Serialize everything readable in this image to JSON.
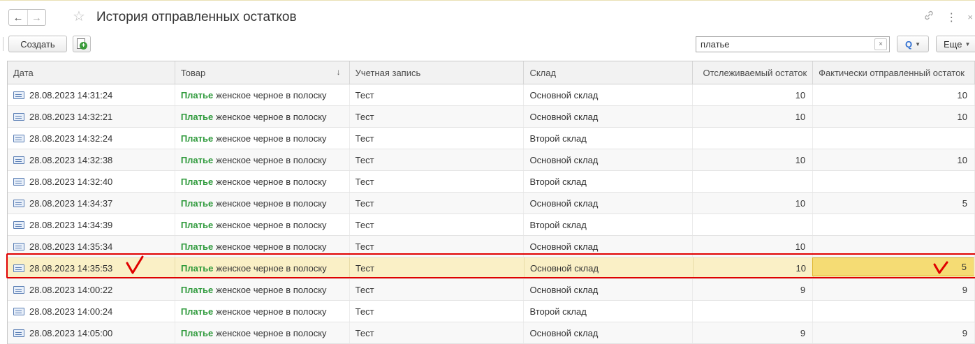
{
  "header": {
    "title": "История отправленных остатков",
    "back_glyph": "←",
    "forward_glyph": "→",
    "star_glyph": "☆",
    "link_glyph": "🔗",
    "more_glyph": "⋮",
    "close_glyph": "×"
  },
  "toolbar": {
    "create_label": "Создать",
    "search_value": "платье",
    "clear_glyph": "×",
    "search_glyph": "Q",
    "more_label": "Еще"
  },
  "table": {
    "columns": [
      "Дата",
      "Товар",
      "Учетная запись",
      "Склад",
      "Отслеживаемый остаток",
      "Фактически отправленный остаток"
    ],
    "sort_glyph": "↓",
    "rows": [
      {
        "date": "28.08.2023 14:31:24",
        "product_hl": "Платье",
        "product_rest": "женское черное в полоску",
        "account": "Тест",
        "warehouse": "Основной склад",
        "tracked": "10",
        "sent": "10"
      },
      {
        "date": "28.08.2023 14:32:21",
        "product_hl": "Платье",
        "product_rest": "женское черное в полоску",
        "account": "Тест",
        "warehouse": "Основной склад",
        "tracked": "10",
        "sent": "10"
      },
      {
        "date": "28.08.2023 14:32:24",
        "product_hl": "Платье",
        "product_rest": "женское черное в полоску",
        "account": "Тест",
        "warehouse": "Второй склад",
        "tracked": "",
        "sent": ""
      },
      {
        "date": "28.08.2023 14:32:38",
        "product_hl": "Платье",
        "product_rest": "женское черное в полоску",
        "account": "Тест",
        "warehouse": "Основной склад",
        "tracked": "10",
        "sent": "10"
      },
      {
        "date": "28.08.2023 14:32:40",
        "product_hl": "Платье",
        "product_rest": "женское черное в полоску",
        "account": "Тест",
        "warehouse": "Второй склад",
        "tracked": "",
        "sent": ""
      },
      {
        "date": "28.08.2023 14:34:37",
        "product_hl": "Платье",
        "product_rest": "женское черное в полоску",
        "account": "Тест",
        "warehouse": "Основной склад",
        "tracked": "10",
        "sent": "5"
      },
      {
        "date": "28.08.2023 14:34:39",
        "product_hl": "Платье",
        "product_rest": "женское черное в полоску",
        "account": "Тест",
        "warehouse": "Второй склад",
        "tracked": "",
        "sent": ""
      },
      {
        "date": "28.08.2023 14:35:34",
        "product_hl": "Платье",
        "product_rest": "женское черное в полоску",
        "account": "Тест",
        "warehouse": "Основной склад",
        "tracked": "10",
        "sent": ""
      },
      {
        "date": "28.08.2023 14:35:53",
        "product_hl": "Платье",
        "product_rest": "женское черное в полоску",
        "account": "Тест",
        "warehouse": "Основной склад",
        "tracked": "10",
        "sent": "5"
      },
      {
        "date": "28.08.2023 14:00:22",
        "product_hl": "Платье",
        "product_rest": "женское черное в полоску",
        "account": "Тест",
        "warehouse": "Основной склад",
        "tracked": "9",
        "sent": "9"
      },
      {
        "date": "28.08.2023 14:00:24",
        "product_hl": "Платье",
        "product_rest": "женское черное в полоску",
        "account": "Тест",
        "warehouse": "Второй склад",
        "tracked": "",
        "sent": ""
      },
      {
        "date": "28.08.2023 14:05:00",
        "product_hl": "Платье",
        "product_rest": "женское черное в полоску",
        "account": "Тест",
        "warehouse": "Основной склад",
        "tracked": "9",
        "sent": "9"
      }
    ]
  },
  "colors": {
    "highlight_text": "#2f9a3c",
    "selected_row": "#faf0c6",
    "selected_cell": "#f5dc74",
    "annotation_red": "#e00000"
  }
}
